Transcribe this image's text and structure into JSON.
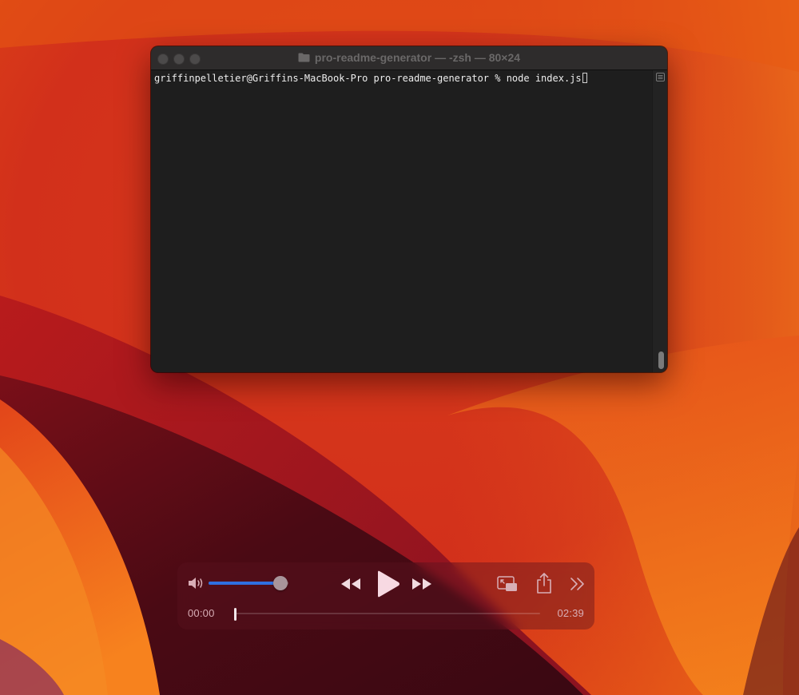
{
  "terminal": {
    "title": "pro-readme-generator — -zsh — 80×24",
    "prompt": "griffinpelletier@Griffins-MacBook-Pro pro-readme-generator % ",
    "command": "node index.js"
  },
  "player": {
    "current_time": "00:00",
    "total_time": "02:39",
    "volume": 0.9,
    "progress": 0.0,
    "accent_color": "#2f6fe0",
    "icons": [
      "speaker-icon",
      "rewind-icon",
      "play-icon",
      "fast-forward-icon",
      "picture-in-picture-icon",
      "share-icon",
      "more-chevron-icon"
    ]
  }
}
